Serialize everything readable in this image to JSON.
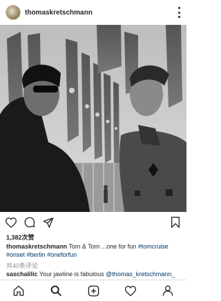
{
  "post": {
    "username": "thomaskretschmann",
    "likes": "1,382次赞",
    "caption": {
      "username": "thomaskretschmann",
      "text": "Tom & Tom ...one for fun",
      "hashtags": [
        "#tomcruise",
        "#onset",
        "#berlin",
        "#oneforfun"
      ]
    },
    "comments_count": "共40条评论",
    "comment": {
      "username": "saschalilic",
      "text": "Your jawline is fabulous",
      "mention": "@thomas_kretschmann_"
    }
  },
  "icons": {
    "header": [
      "avatar",
      "more-icon"
    ],
    "actions": [
      "heart-icon",
      "comment-icon",
      "share-icon",
      "bookmark-icon"
    ],
    "tabs": [
      "home-icon",
      "search-icon",
      "add-post-icon",
      "activity-heart-icon",
      "profile-icon"
    ]
  },
  "colors": {
    "text": "#262626",
    "hashtag": "#00376b",
    "muted": "#8e8e8e"
  }
}
